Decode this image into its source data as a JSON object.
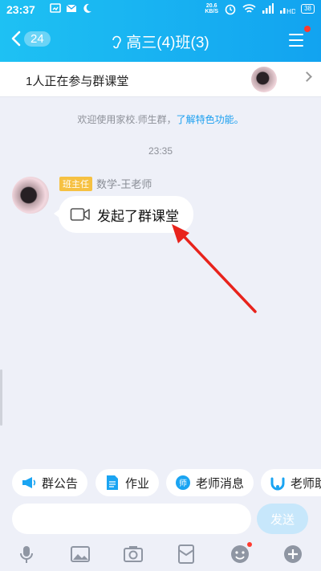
{
  "statusbar": {
    "time": "23:37",
    "speed_top": "20.6",
    "speed_bottom": "KB/S",
    "battery": "38"
  },
  "navbar": {
    "unread_count": "24",
    "title": "高三(4)班(3)"
  },
  "banner": {
    "text": "1人正在参与群课堂"
  },
  "chat": {
    "system_text": "欢迎使用家校.师生群，",
    "system_link": "了解特色功能。",
    "time": "23:35",
    "message": {
      "role": "班主任",
      "sender": "数学-王老师",
      "text": "发起了群课堂"
    }
  },
  "quick_actions": [
    {
      "label": "群公告",
      "icon": "megaphone-icon"
    },
    {
      "label": "作业",
      "icon": "document-icon"
    },
    {
      "label": "老师消息",
      "icon": "teacher-icon"
    },
    {
      "label": "老师助",
      "icon": "assistant-icon"
    }
  ],
  "input": {
    "placeholder": "",
    "send_label": "发送"
  },
  "toolbar": [
    "voice-icon",
    "image-icon",
    "camera-icon",
    "red-packet-icon",
    "emoji-icon",
    "plus-icon"
  ],
  "colors": {
    "header": "#17b3f2",
    "link": "#1a9ff0",
    "arrow": "#e8231c",
    "badge": "#f6c142"
  }
}
